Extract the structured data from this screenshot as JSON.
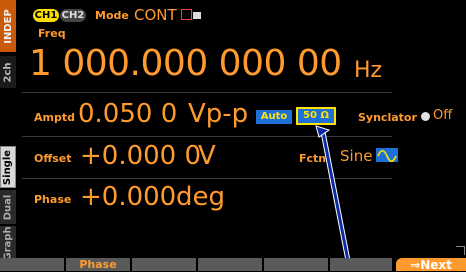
{
  "side_tabs": {
    "indep": "INDEP",
    "ch2": "2ch",
    "single": "Single",
    "dual": "Dual",
    "graph": "Graph"
  },
  "header": {
    "ch1": "CH1",
    "ch2": "CH2",
    "mode_label": "Mode",
    "mode_value": "CONT",
    "indicator_icon": "square-marker-icon"
  },
  "freq": {
    "label": "Freq",
    "value": "1 000.000 000 00",
    "unit": "Hz"
  },
  "amptd": {
    "label": "Amptd",
    "value": "0.050 0",
    "unit": "Vp-p",
    "auto_label": "Auto",
    "load_label": "50 Ω"
  },
  "synclator": {
    "label": "Synclator",
    "value": "Off"
  },
  "offset": {
    "label": "Offset",
    "value": "+0.000 0",
    "unit": "V"
  },
  "fctn": {
    "label": "Fctn",
    "value": "Sine",
    "icon": "sine-wave-icon"
  },
  "phase": {
    "label": "Phase",
    "value": "+0.000",
    "unit": "deg"
  },
  "softkeys": [
    "",
    "Phase",
    "",
    "",
    "",
    "",
    "⇒Next"
  ],
  "colors": {
    "accent": "#ff9a2e",
    "highlight": "#ffe400",
    "auto_bg": "#1c70d8",
    "softkey_bg": "#5a5a5a",
    "pointer": "#0a2aa8"
  }
}
